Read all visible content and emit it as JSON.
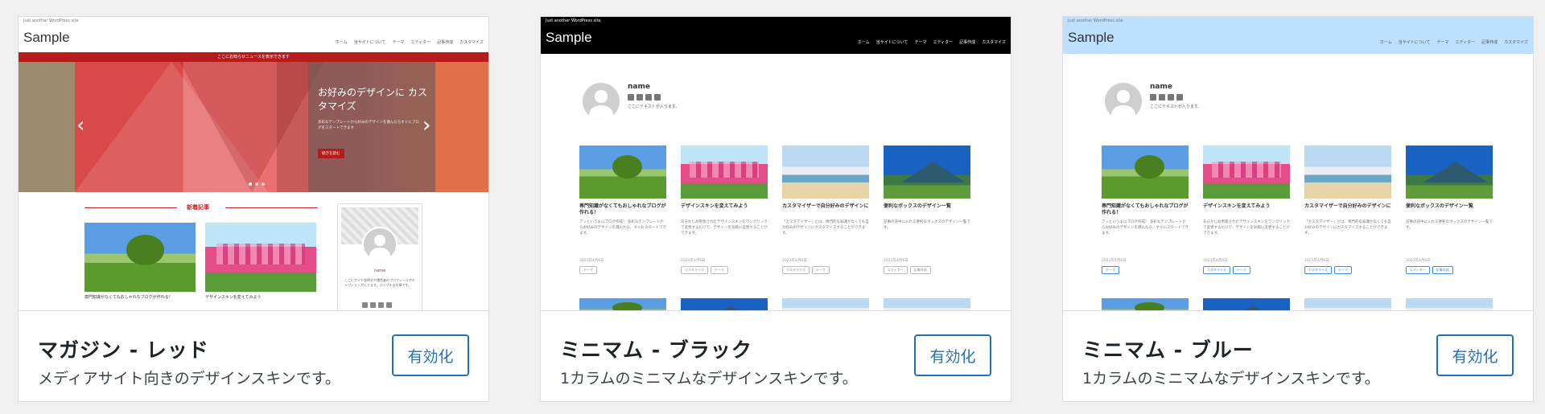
{
  "cards": [
    {
      "title": "マガジン - レッド",
      "description": "メディアサイト向きのデザインスキンです。",
      "button": "有効化",
      "site": {
        "tagline": "Just another WordPress site",
        "logo": "Sample",
        "nav": [
          "ホーム",
          "当サイトについて",
          "テーマ",
          "エディター",
          "記事作成",
          "カスタマイズ"
        ],
        "notice": "ここにお知らせニュースを表示できます",
        "slide_title": "お好みのデザインに カスタマイズ",
        "slide_text": "多彩なテンプレートから好みのデザインを選んだらすぐにブログをスタートできます",
        "slide_button": "続きを読む",
        "section_heading": "新着記事",
        "post_captions": [
          "専門知識がなくてもおしゃれなブログが作れる！",
          "デザインスキンを変えてみよう"
        ],
        "profile_name": "name",
        "profile_text": "ここにサイト説明文や運営者のプロフィールやキャプションが入ります。シンプルな文章です。"
      }
    },
    {
      "title": "ミニマム - ブラック",
      "description": "1カラムのミニマムなデザインスキンです。",
      "button": "有効化",
      "site": {
        "tagline": "Just another WordPress site",
        "logo": "Sample",
        "nav": [
          "ホーム",
          "当サイトについて",
          "テーマ",
          "エディター",
          "記事作成",
          "カスタマイズ"
        ],
        "profile_name": "name",
        "profile_text": "ここにテキストが入ります。",
        "posts": [
          {
            "title": "専門知識がなくてもおしゃれなブログが作れる！",
            "excerpt": "アッというまにブログ作成！ 多彩なテンプレートからお好みのデザインを選んだら、すぐにスタートできます。",
            "date": "2021年4月6日",
            "tags": [
              "テーマ"
            ]
          },
          {
            "title": "デザインスキンを変えてみよう",
            "excerpt": "あらかじめ用意されたデザインスキンをワンクリックで変更するだけで、デザインを気軽に変更することができます。",
            "date": "2021年4月6日",
            "tags": [
              "カスタマイズ",
              "テーマ"
            ]
          },
          {
            "title": "カスタマイザーで自分好みのデザインに",
            "excerpt": "「カスタマイザー」とは、専門的な知識がなくても自分好みのデザインにカスタマイズすることができます。",
            "date": "2021年4月6日",
            "tags": [
              "カスタマイズ",
              "テーマ"
            ]
          },
          {
            "title": "便利なボックスのデザイン一覧",
            "excerpt": "記事の途中に入れる便利なボックスのデザイン一覧です。",
            "date": "2021年4月6日",
            "tags": [
              "エディター",
              "記事作成"
            ]
          }
        ]
      }
    },
    {
      "title": "ミニマム - ブルー",
      "description": "1カラムのミニマムなデザインスキンです。",
      "button": "有効化",
      "site": {
        "tagline": "Just another WordPress site",
        "logo": "Sample",
        "nav": [
          "ホーム",
          "当サイトについて",
          "テーマ",
          "エディター",
          "記事作成",
          "カスタマイズ"
        ],
        "profile_name": "name",
        "profile_text": "ここにテキストが入ります。",
        "posts": [
          {
            "title": "専門知識がなくてもおしゃれなブログが作れる！",
            "excerpt": "アッというまにブログ作成！ 多彩なテンプレートからお好みのデザインを選んだら、すぐにスタートできます。",
            "date": "2021年4月6日",
            "tags": [
              "テーマ"
            ]
          },
          {
            "title": "デザインスキンを変えてみよう",
            "excerpt": "あらかじめ用意されたデザインスキンをワンクリックで変更するだけで、デザインを気軽に変更することができます。",
            "date": "2021年4月6日",
            "tags": [
              "カスタマイズ",
              "テーマ"
            ]
          },
          {
            "title": "カスタマイザーで自分好みのデザインに",
            "excerpt": "「カスタマイザー」とは、専門的な知識がなくても自分好みのデザインにカスタマイズすることができます。",
            "date": "2021年4月6日",
            "tags": [
              "カスタマイズ",
              "テーマ"
            ]
          },
          {
            "title": "便利なボックスのデザイン一覧",
            "excerpt": "記事の途中に入れる便利なボックスのデザイン一覧です。",
            "date": "2021年4月6日",
            "tags": [
              "エディター",
              "記事作成"
            ]
          }
        ]
      }
    }
  ],
  "colors": {
    "accent": "#2271b1",
    "magazine_red": "#b71c1c",
    "minimal_black": "#000000",
    "minimal_blue": "#bde0fe"
  }
}
